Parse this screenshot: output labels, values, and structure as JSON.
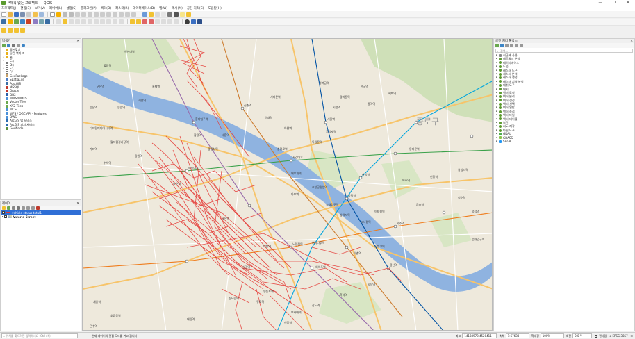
{
  "window": {
    "title": "*제목 없는 프로젝트 — QGIS",
    "minimize": "—",
    "maximize": "❐",
    "close": "✕"
  },
  "menu": [
    "프로젝트(J)",
    "편집(E)",
    "보기(V)",
    "레이어(L)",
    "설정(S)",
    "플러그인(P)",
    "벡터(O)",
    "래스터(R)",
    "데이터베이스(D)",
    "웹(W)",
    "메시(M)",
    "공간 처리(C)",
    "도움말(H)"
  ],
  "browser_panel": {
    "title": "탐색기",
    "items": [
      {
        "label": "즐겨찾기",
        "color": "#e7b01a",
        "expand": ""
      },
      {
        "label": "공간 북마크",
        "color": "#e7b01a",
        "expand": "▸"
      },
      {
        "label": "홈",
        "color": "#e7b01a",
        "expand": "▸"
      },
      {
        "label": "C:\\",
        "color": "#ffffff",
        "expand": "▸"
      },
      {
        "label": "D:\\",
        "color": "#ffffff",
        "expand": "▸"
      },
      {
        "label": "E:\\",
        "color": "#ffffff",
        "expand": "▸"
      },
      {
        "label": "F:\\",
        "color": "#ffffff",
        "expand": "▸"
      },
      {
        "label": "GeoPackage",
        "color": "#c8a26a",
        "expand": ""
      },
      {
        "label": "SpatiaLite",
        "color": "#4a7bc6",
        "expand": ""
      },
      {
        "label": "PostGIS",
        "color": "#3a6ea5",
        "expand": ""
      },
      {
        "label": "MSSQL",
        "color": "#c0392b",
        "expand": ""
      },
      {
        "label": "Oracle",
        "color": "#c0392b",
        "expand": ""
      },
      {
        "label": "DB2",
        "color": "#2c5fa8",
        "expand": ""
      },
      {
        "label": "WMS/WMTS",
        "color": "#4a90d9",
        "expand": ""
      },
      {
        "label": "Vector Tiles",
        "color": "#6aa84f",
        "expand": ""
      },
      {
        "label": "XYZ Tiles",
        "color": "#6aa84f",
        "expand": "▸"
      },
      {
        "label": "WCS",
        "color": "#4a90d9",
        "expand": ""
      },
      {
        "label": "WFS / OGC API - Features",
        "color": "#4a90d9",
        "expand": ""
      },
      {
        "label": "OWS",
        "color": "#4a90d9",
        "expand": ""
      },
      {
        "label": "ArcGIS 맵 서비스",
        "color": "#2b6cb0",
        "expand": ""
      },
      {
        "label": "ArcGIS 피처 서비스",
        "color": "#2b6cb0",
        "expand": ""
      },
      {
        "label": "GeoNode",
        "color": "#5a8f3e",
        "expand": ""
      }
    ]
  },
  "layers_panel": {
    "title": "레이어",
    "layers": [
      {
        "label": "vehicle-status-total1",
        "checked": true,
        "selected": true,
        "color": "#e53935"
      },
      {
        "label": "Vworld Street",
        "checked": true,
        "selected": false,
        "color": "#7aa2d8"
      }
    ]
  },
  "processing_panel": {
    "title": "공간 처리 툴박스",
    "search_placeholder": "검색...",
    "items": [
      {
        "label": "최근에 사용",
        "color": "#888888"
      },
      {
        "label": "네트워크 분석",
        "color": "#5b9a2e"
      },
      {
        "label": "데이터베이스",
        "color": "#5b9a2e"
      },
      {
        "label": "도움",
        "color": "#5b9a2e"
      },
      {
        "label": "래스터 도구",
        "color": "#5b9a2e"
      },
      {
        "label": "래스터 분석",
        "color": "#5b9a2e"
      },
      {
        "label": "래스터 생성",
        "color": "#5b9a2e"
      },
      {
        "label": "래스터 지형 분석",
        "color": "#5b9a2e"
      },
      {
        "label": "메쉬 도구",
        "color": "#5b9a2e"
      },
      {
        "label": "메시",
        "color": "#5b9a2e"
      },
      {
        "label": "벡터 도형",
        "color": "#5b9a2e"
      },
      {
        "label": "벡터 분석",
        "color": "#5b9a2e"
      },
      {
        "label": "벡터 생성",
        "color": "#5b9a2e"
      },
      {
        "label": "벡터 선택",
        "color": "#5b9a2e"
      },
      {
        "label": "벡터 일반",
        "color": "#5b9a2e"
      },
      {
        "label": "벡터 중첩",
        "color": "#5b9a2e"
      },
      {
        "label": "벡터 타일",
        "color": "#5b9a2e"
      },
      {
        "label": "벡터 테이블",
        "color": "#5b9a2e"
      },
      {
        "label": "보간",
        "color": "#5b9a2e"
      },
      {
        "label": "지도 제작",
        "color": "#5b9a2e"
      },
      {
        "label": "파일 도구",
        "color": "#5b9a2e"
      },
      {
        "label": "GDAL",
        "color": "#4caf50"
      },
      {
        "label": "GRASS",
        "color": "#8bc34a"
      },
      {
        "label": "SAGA",
        "color": "#2196f3"
      }
    ]
  },
  "map": {
    "district_name": "종로구",
    "river_color": "#8fb3e0",
    "track_color": "#e53935",
    "labels": [
      "마포대교",
      "서강대교",
      "여의나루역",
      "여의도역",
      "공덕역",
      "서울역",
      "용산역",
      "노량진역",
      "대방역",
      "신길역",
      "영등포역",
      "당산역",
      "합정역",
      "홍대입구역",
      "신촌역",
      "이대역",
      "아현역",
      "충정로역",
      "시청역",
      "종각역",
      "안국역",
      "광화문역",
      "경복궁역",
      "동대문역",
      "혜화역",
      "한남역",
      "옥수역",
      "금호역",
      "약수역",
      "신당역",
      "왕십리역",
      "성수역",
      "뚝섬역",
      "건대입구역",
      "구로역",
      "신도림역",
      "대림역",
      "보라매역",
      "신풍역",
      "상도역",
      "흑석역",
      "동작역",
      "이촌역",
      "서빙고역",
      "이태원역",
      "녹사평역",
      "삼각지역",
      "숙대입구역",
      "효창공원앞역",
      "마포역",
      "애오개역",
      "독립문역",
      "무악재역",
      "홍제역",
      "불광역",
      "연신내역",
      "구산역",
      "응암역",
      "새절역",
      "증산역",
      "디지털미디어시티역",
      "월드컵경기장역",
      "망원역",
      "상수역",
      "광흥창역",
      "대흥역",
      "서대문역",
      "가좌역",
      "수색역",
      "개봉역",
      "오류동역",
      "온수역"
    ]
  },
  "status": {
    "search_placeholder": "위치를 찾으려면 입력하세요 (Ctrl+K)",
    "message": "현재 레이어의 편집 모드를 켜고/끕니다",
    "coord_label": "좌표",
    "coord_value": "14138978,4520411",
    "scale_label": "축척",
    "scale_value": "1:67688",
    "magnifier_label": "확대경",
    "magnifier_value": "100%",
    "rotation_label": "회전",
    "rotation_value": "0.0 °",
    "render_label": "렌더링",
    "crs_label": "EPSG:3857"
  }
}
